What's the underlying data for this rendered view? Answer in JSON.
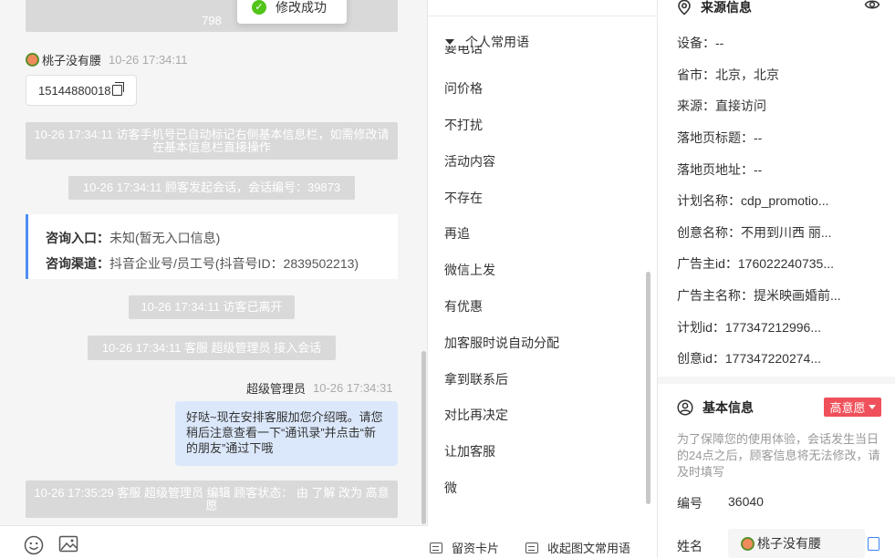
{
  "chat": {
    "top_system_fragment": "798",
    "toast_text": "修改成功",
    "visitor_name": "桃子没有腰",
    "visitor_time": "10-26 17:34:11",
    "phone": "15144880018",
    "sys1": "10-26 17:34:11 访客手机号已自动标记右侧基本信息栏，如需修改请在基本信息栏直接操作",
    "sys2": "10-26 17:34:11 顾客发起会话，会话编号：39873",
    "entry_label": "咨询入口：",
    "entry_value": "未知(暂无入口信息)",
    "channel_label": "咨询渠道：",
    "channel_value": "抖音企业号/员工号(抖音号ID：2839502213)",
    "sys3": "10-26 17:34:11 访客已离开",
    "sys4": "10-26 17:34:11 客服 超级管理员 接入会话",
    "agent_name": "超级管理员",
    "agent_time": "10-26 17:34:31",
    "agent_message": "好哒~现在安排客服加您介绍哦。请您稍后注意查看一下“通讯录”并点击“新的朋友”通过下哦",
    "sys5": "10-26 17:35:29 客服 超级管理员 编辑 顾客状态： 由 了解 改为 高意愿"
  },
  "phrases": {
    "group_title": "个人常用语",
    "cut_item": "要电话",
    "items": [
      "问价格",
      "不打扰",
      "活动内容",
      "不存在",
      "再追",
      "微信上发",
      "有优惠",
      "加客服时说自动分配",
      "拿到联系后",
      "对比再决定",
      "让加客服",
      "微"
    ],
    "footer_card": "留资卡片",
    "footer_collapse": "收起图文常用语"
  },
  "info": {
    "source_title": "来源信息",
    "source_rows": [
      "设备：--",
      "省市：北京，北京",
      "来源：直接访问",
      "落地页标题：--",
      "落地页地址：--",
      "计划名称：cdp_promotio...",
      "创意名称：不用到川西 丽...",
      "广告主id：176022240735...",
      "广告主名称：提米映画婚前...",
      "计划id：177347212996...",
      "创意id：177347220274..."
    ],
    "basic_title": "基本信息",
    "intent_badge": "高意愿",
    "notice": "为了保障您的使用体验，会话发生当日的24点之后，顾客信息将无法修改，请及时填写",
    "number_label": "编号",
    "number_value": "36040",
    "name_label": "姓名",
    "name_value": "桃子没有腰"
  }
}
